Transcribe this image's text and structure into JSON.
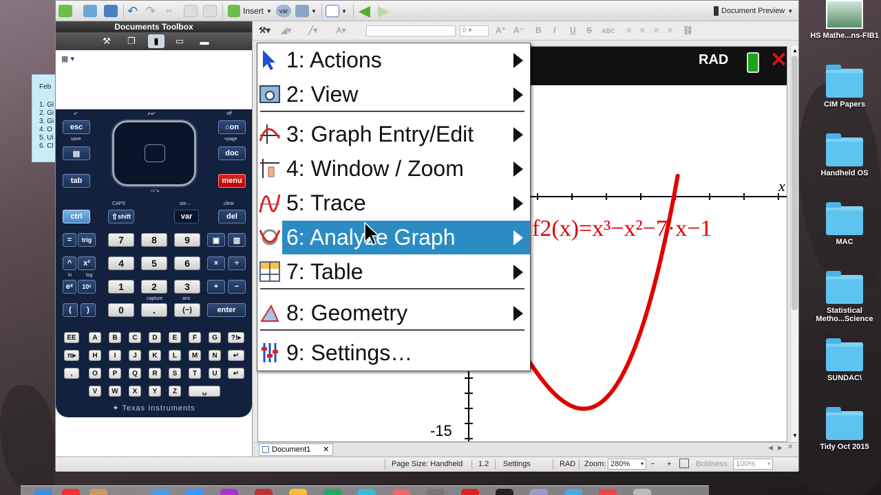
{
  "toolbar": {
    "insert_label": "Insert",
    "var_label": "var",
    "document_preview_label": "Document Preview"
  },
  "toolbox": {
    "title": "Documents Toolbox",
    "tabs": [
      "tools-icon",
      "page-sorter-icon",
      "calculator-icon",
      "book-icon",
      "folder-icon"
    ]
  },
  "sticky": {
    "title": "Feb",
    "lines": [
      "1. Gi",
      "2. Gi",
      "3. Gi",
      "4. O",
      "5. Ui",
      "6. Cl"
    ]
  },
  "calculator": {
    "keys": {
      "esc": "esc",
      "on": "on",
      "doc": "doc",
      "tab": "tab",
      "menu": "menu",
      "ctrl": "ctrl",
      "shift": "shift",
      "var": "var",
      "del": "del",
      "equals": "=",
      "trig": "trig",
      "enter": "enter",
      "neg": "(−)",
      "lparen": "(",
      "rparen": ")",
      "point": ".",
      "n0": "0",
      "n1": "1",
      "n2": "2",
      "n3": "3",
      "n4": "4",
      "n5": "5",
      "n6": "6",
      "n7": "7",
      "n8": "8",
      "n9": "9",
      "caret": "^",
      "x2": "x²",
      "ex": "eˣ",
      "tenx": "10ˣ",
      "times": "×",
      "divide": "÷",
      "plus": "+",
      "minus": "−"
    },
    "small_labels": {
      "save": "save",
      "off": "off",
      "page": "+page",
      "caps": "CAPS",
      "sto": "sto→",
      "clear": "clear",
      "capture": "capture",
      "ans": "ans",
      "ln": "ln",
      "log": "log"
    },
    "alpha_rows": [
      [
        "EE",
        "A",
        "B",
        "C",
        "D",
        "E",
        "F",
        "G",
        "?!▸"
      ],
      [
        "π▸",
        "H",
        "I",
        "J",
        "K",
        "L",
        "M",
        "N",
        "↵"
      ],
      [
        ",",
        "O",
        "P",
        "Q",
        "R",
        "S",
        "T",
        "U",
        "↵"
      ],
      [
        "V",
        "W",
        "X",
        "Y",
        "Z",
        "␣"
      ]
    ],
    "brand": "Texas Instruments"
  },
  "menu": {
    "items": [
      {
        "num": "1:",
        "label": "Actions",
        "icon": "pointer-arrow-icon",
        "arrow": true,
        "selected": false
      },
      {
        "num": "2:",
        "label": "View",
        "icon": "view-camera-icon",
        "arrow": true,
        "selected": false
      },
      {
        "num": "3:",
        "label": "Graph Entry/Edit",
        "icon": "graph-entry-icon",
        "arrow": true,
        "selected": false
      },
      {
        "num": "4:",
        "label": "Window / Zoom",
        "icon": "window-zoom-icon",
        "arrow": true,
        "selected": false
      },
      {
        "num": "5:",
        "label": "Trace",
        "icon": "trace-icon",
        "arrow": true,
        "selected": false
      },
      {
        "num": "6:",
        "label": "Analyze Graph",
        "icon": "analyze-graph-icon",
        "arrow": true,
        "selected": true
      },
      {
        "num": "7:",
        "label": "Table",
        "icon": "table-icon",
        "arrow": true,
        "selected": false
      },
      {
        "num": "8:",
        "label": "Geometry",
        "icon": "geometry-icon",
        "arrow": true,
        "selected": false
      },
      {
        "num": "9:",
        "label": "Settings…",
        "icon": "settings-icon",
        "arrow": false,
        "selected": false
      }
    ]
  },
  "graph": {
    "mode": "RAD",
    "function_label": "f2(x)=x³−x²−7·x−1",
    "axis_label_x": "x",
    "tick_label_y": "-15",
    "curve_color": "#e00000"
  },
  "tabs": {
    "document_tab": "Document1"
  },
  "status": {
    "page_size_label": "Page Size: Handheld",
    "version": "1.2",
    "settings": "Settings",
    "mode": "RAD",
    "zoom_label": "Zoom:",
    "zoom_value": "280%",
    "boldness_label": "Boldness:",
    "boldness_value": "100%"
  },
  "desktop": {
    "icons": [
      {
        "label": "HS Mathe...ns-FIB1",
        "kind": "thumbnail"
      },
      {
        "label": "CIM Papers",
        "kind": "folder"
      },
      {
        "label": "Handheld OS",
        "kind": "folder"
      },
      {
        "label": "MAC",
        "kind": "folder"
      },
      {
        "label": "Statistical Metho...Science",
        "kind": "folder"
      },
      {
        "label": "SUNDAC\\",
        "kind": "folder"
      },
      {
        "label": "Tidy Oct 2015",
        "kind": "folder"
      }
    ]
  },
  "colors": {
    "menu_highlight": "#2b8cc4",
    "calculator_body": "#12213d",
    "menu_key": "#e02424"
  }
}
